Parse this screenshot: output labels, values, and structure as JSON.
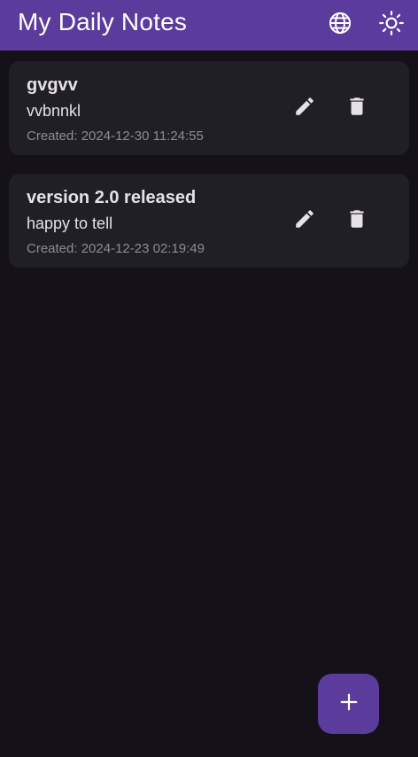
{
  "app_bar": {
    "title": "My Daily Notes",
    "language_icon": "globe-icon",
    "theme_icon": "sun-icon",
    "color": "#5b3b9b"
  },
  "notes": [
    {
      "title": "gvgvv",
      "body": "vvbnnkl",
      "created": "Created: 2024-12-30 11:24:55"
    },
    {
      "title": "version 2.0 released",
      "body": "happy to tell",
      "created": "Created: 2024-12-23 02:19:49"
    }
  ],
  "fab": {
    "icon": "plus-icon",
    "color": "#5b3b9b"
  },
  "colors": {
    "background": "#141218",
    "card": "#211f26",
    "text": "#e6e1e9",
    "muted": "#8f8a96"
  }
}
